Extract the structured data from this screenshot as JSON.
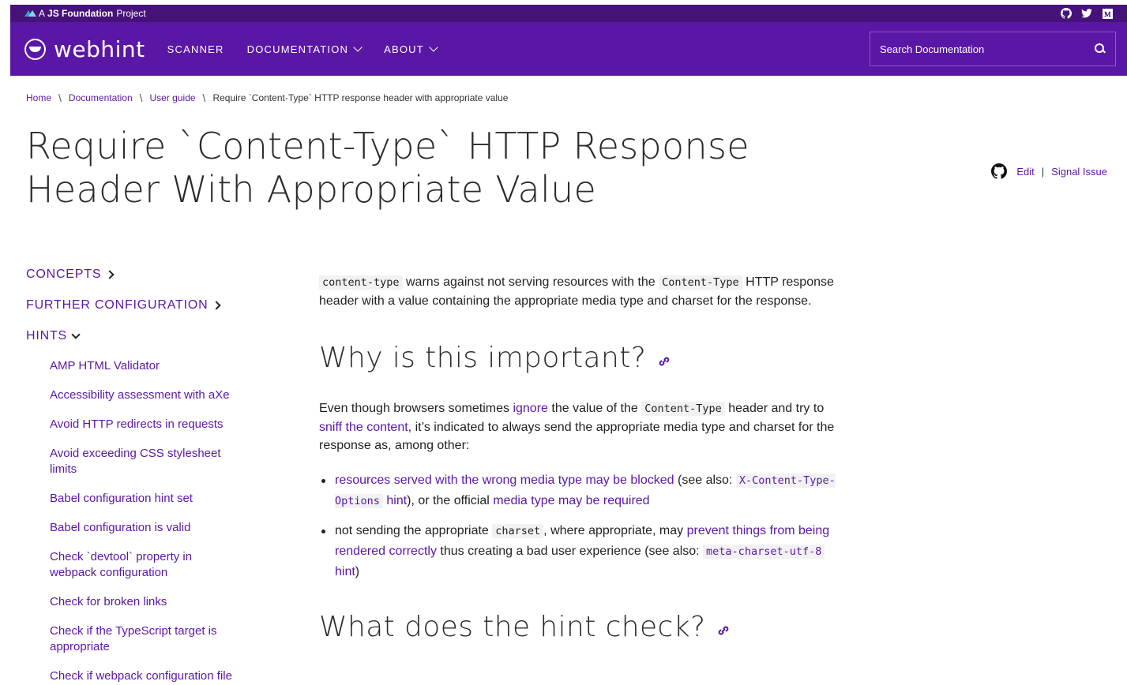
{
  "topbar": {
    "prefix": "A",
    "org": "JS Foundation",
    "suffix": "Project",
    "social_icons": [
      "github-icon",
      "twitter-icon",
      "medium-icon"
    ]
  },
  "nav": {
    "logo_text": "webhint",
    "items": [
      {
        "label": "SCANNER",
        "has_dropdown": false
      },
      {
        "label": "DOCUMENTATION",
        "has_dropdown": true
      },
      {
        "label": "ABOUT",
        "has_dropdown": true
      }
    ],
    "search_placeholder": "Search Documentation"
  },
  "breadcrumb": {
    "items": [
      "Home",
      "Documentation",
      "User guide"
    ],
    "current": "Require `Content-Type` HTTP response header with appropriate value"
  },
  "title": {
    "line1": "Require `Content-Type` HTTP Response",
    "line2": "Header With Appropriate Value"
  },
  "edit": {
    "edit_label": "Edit",
    "separator": "|",
    "signal_label": "Signal Issue"
  },
  "sidebar": {
    "sections": [
      {
        "label": "CONCEPTS",
        "expanded": false
      },
      {
        "label": "FURTHER CONFIGURATION",
        "expanded": false
      },
      {
        "label": "HINTS",
        "expanded": true
      }
    ],
    "hints": [
      "AMP HTML Validator",
      "Accessibility assessment with aXe",
      "Avoid HTTP redirects in requests",
      "Avoid exceeding CSS stylesheet limits",
      "Babel configuration hint set",
      "Babel configuration is valid",
      "Check `devtool` property in webpack configuration",
      "Check for broken links",
      "Check if the TypeScript target is appropriate",
      "Check if webpack configuration file"
    ]
  },
  "content": {
    "intro": {
      "code1": "content-type",
      "t1": " warns against not serving resources with the ",
      "code2": "Content-Type",
      "t2": " HTTP response header with a value containing the appropriate media type and charset for the response."
    },
    "h2_why": "Why is this important?",
    "why_p": {
      "t1": "Even though browsers sometimes ",
      "link_ignore": "ignore",
      "t2": " the value of the ",
      "code": "Content-Type",
      "t3": " header and try to ",
      "link_sniff": "sniff the content",
      "t4": ", it’s indicated to always send the appropriate media type and charset for the response as, among other:"
    },
    "bullet1": {
      "link1": "resources served with the wrong media type may be blocked",
      "t1": " (see also: ",
      "code": "X-Content-Type-Options",
      "link2": "hint",
      "t2": "), or the official ",
      "link3": "media type may be required"
    },
    "bullet2": {
      "t1": "not sending the appropriate ",
      "code1": "charset",
      "t2": ", where appropriate, may ",
      "link1": "prevent things from being rendered correctly",
      "t3": " thus creating a bad user experience (see also: ",
      "code2": "meta-charset-utf-8",
      "link2": "hint",
      "t4": ")"
    },
    "h2_what": "What does the hint check?"
  },
  "colors": {
    "topbar_bg": "#45127a",
    "nav_bg": "#5a17a5",
    "link": "#5a17a5"
  }
}
